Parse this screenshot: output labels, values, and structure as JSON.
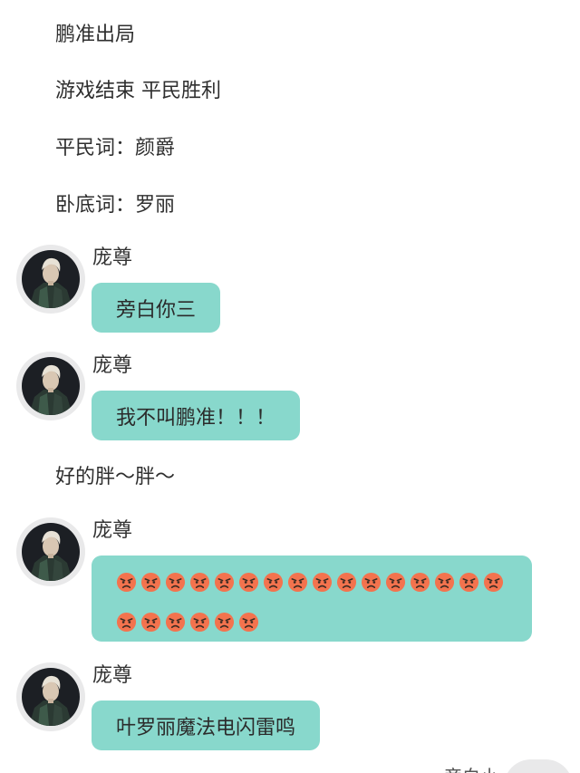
{
  "narration": [
    "鹏准出局",
    "游戏结束 平民胜利",
    "平民词：颜爵",
    "卧底词：罗丽"
  ],
  "messages": [
    {
      "sender": "庞尊",
      "text": "旁白你三"
    },
    {
      "sender": "庞尊",
      "text": "我不叫鹏准！！！"
    },
    {
      "sender": "庞尊",
      "emoji": "angry-face",
      "emoji_count": 22
    },
    {
      "sender": "庞尊",
      "text": "叶罗丽魔法电闪雷鸣"
    }
  ],
  "narration_mid": "好的胖～胖～",
  "bottom_partial_text": "旁白小",
  "colors": {
    "bubble": "#88d8cc",
    "avatar_ring": "#e9e9ea",
    "emoji_face": "#f3734e"
  }
}
